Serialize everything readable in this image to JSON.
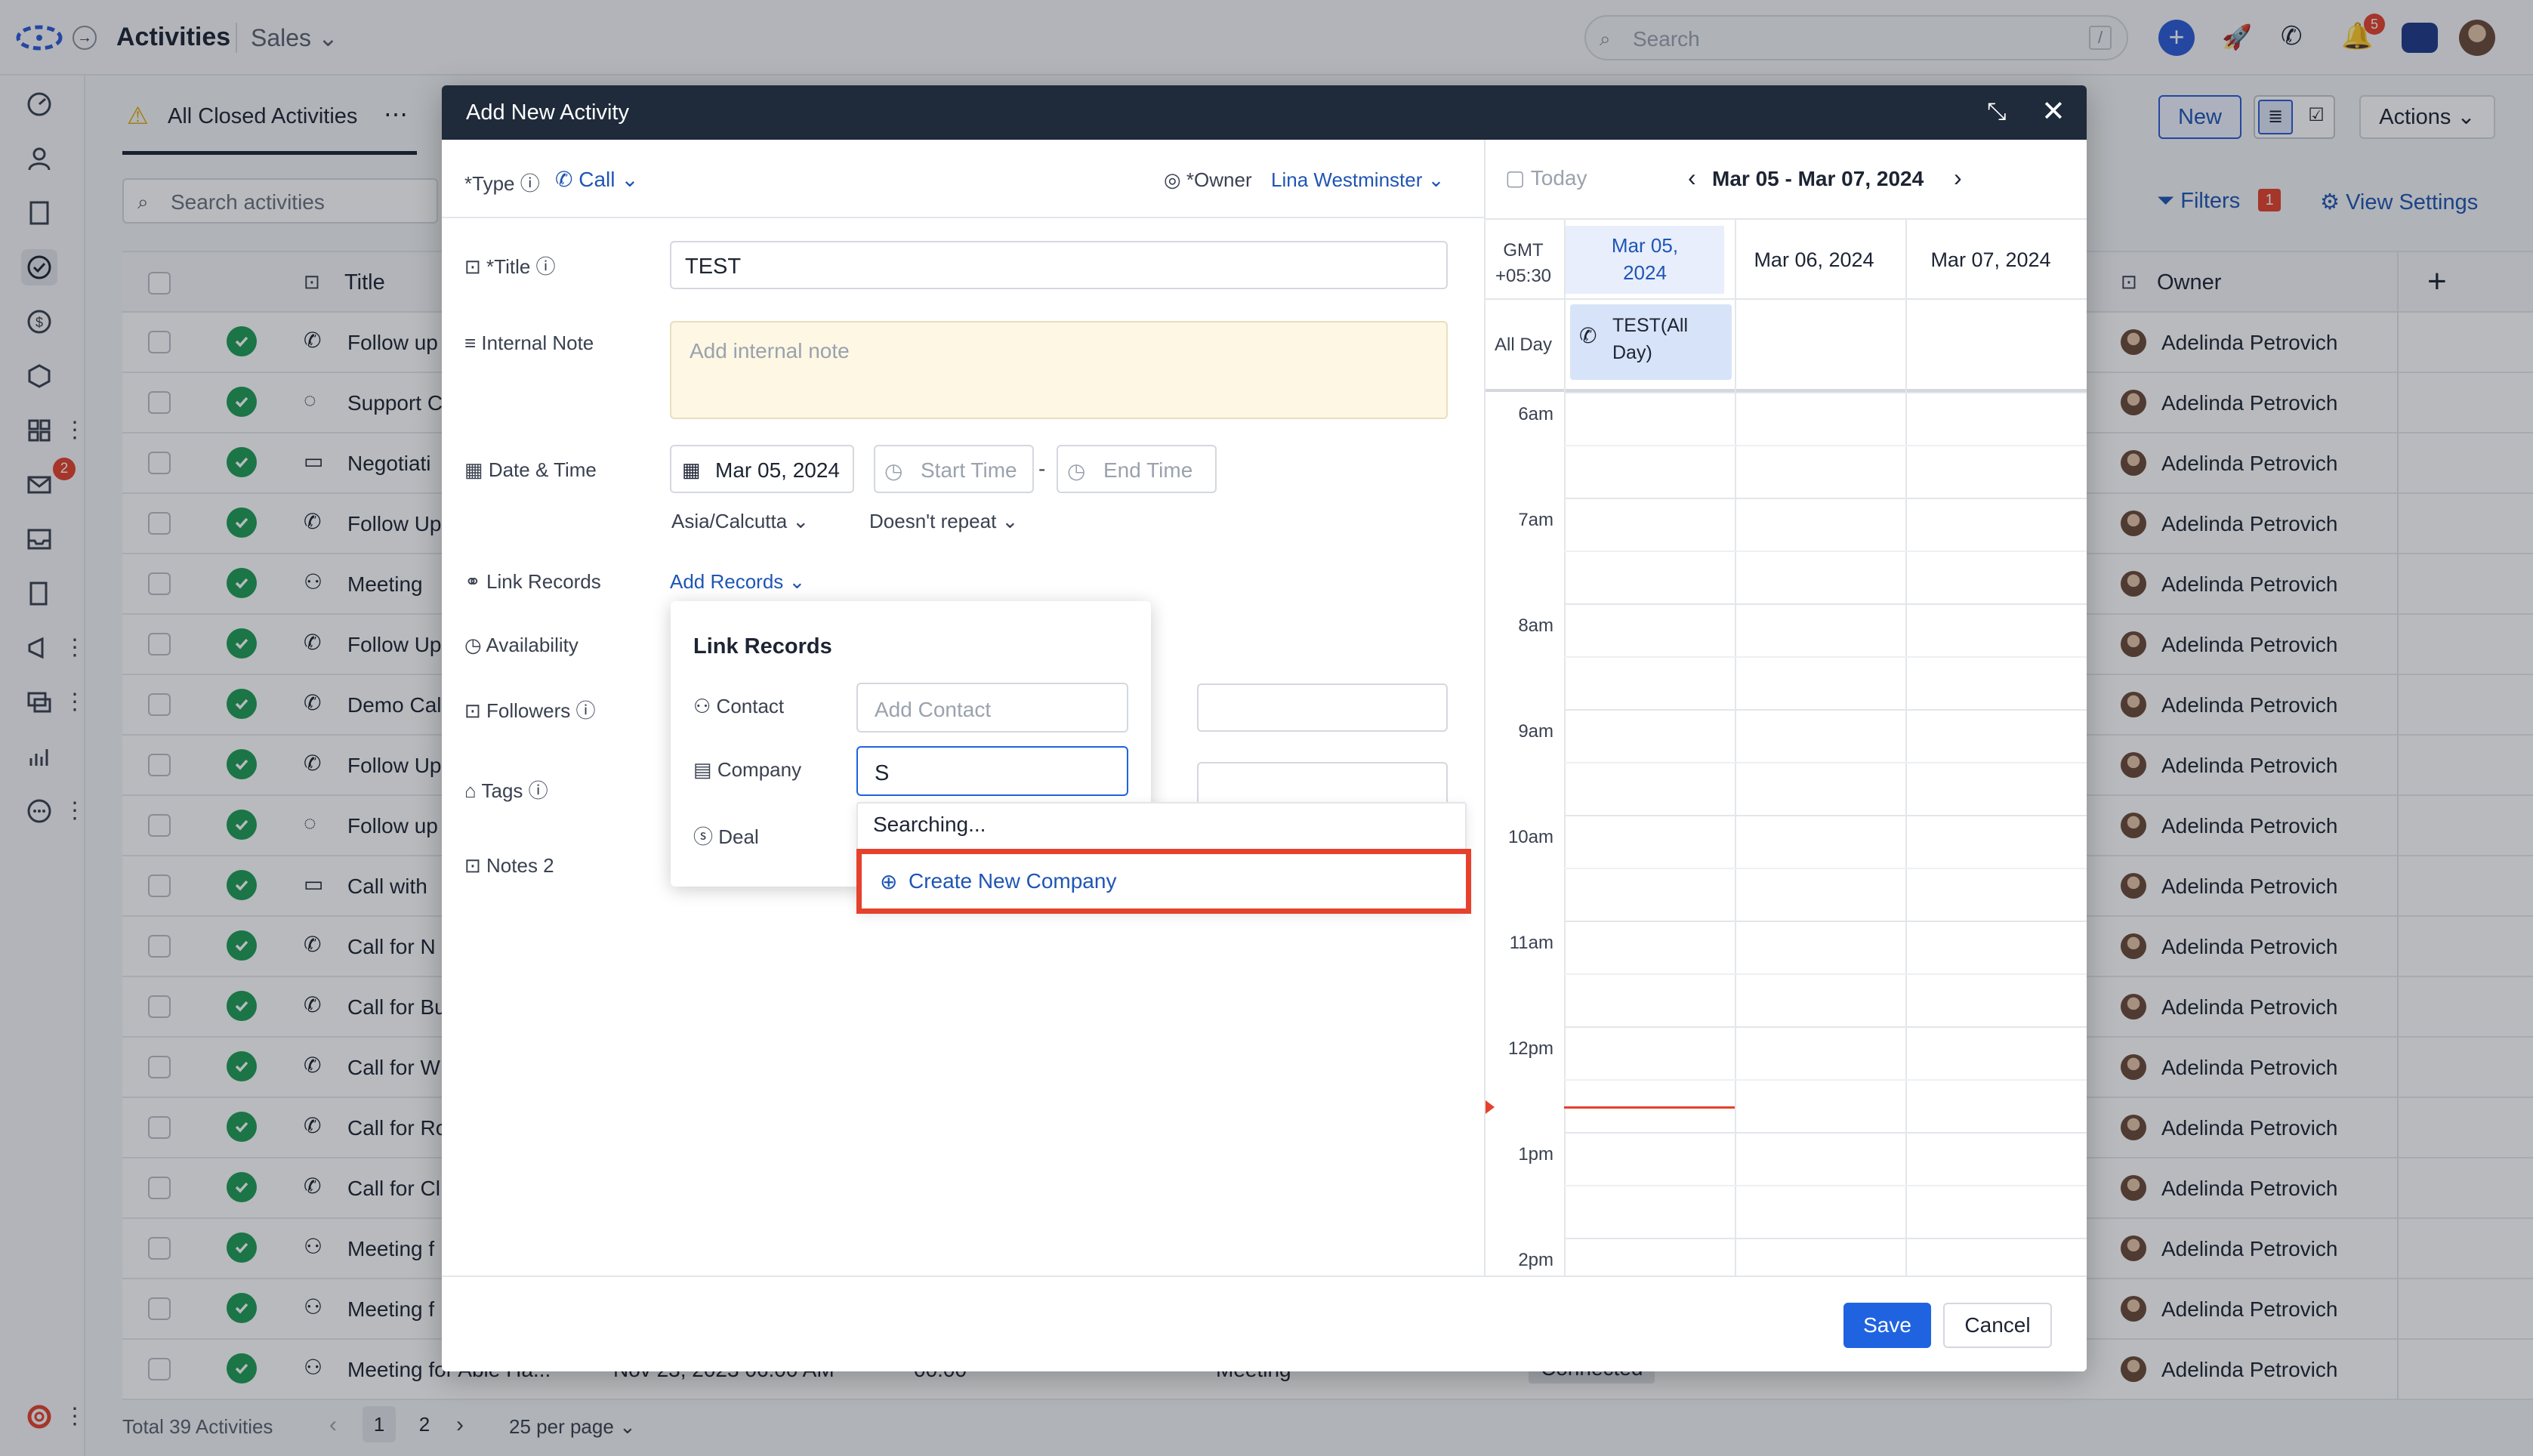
{
  "app": {
    "title": "Activities",
    "module": "Sales",
    "search_placeholder": "Search",
    "search_shortcut": "/",
    "notif_count": "5"
  },
  "sidebar": {
    "mail_badge": "2"
  },
  "list": {
    "view_name": "All Closed Activities",
    "search_placeholder": "Search activities",
    "new_label": "New",
    "actions_label": "Actions",
    "filters_label": "Filters",
    "filters_count": "1",
    "view_settings_label": "View Settings",
    "col_title": "Title",
    "col_owner": "Owner",
    "rows": [
      {
        "title": "Follow up",
        "icon": "phone-icon",
        "owner": "Adelinda Petrovich"
      },
      {
        "title": "Support C",
        "icon": "bulb-icon",
        "owner": "Adelinda Petrovich"
      },
      {
        "title": "Negotiati",
        "icon": "chat-icon",
        "owner": "Adelinda Petrovich"
      },
      {
        "title": "Follow Up",
        "icon": "phone-icon",
        "owner": "Adelinda Petrovich"
      },
      {
        "title": "Meeting",
        "icon": "people-icon",
        "owner": "Adelinda Petrovich"
      },
      {
        "title": "Follow Up",
        "icon": "phone-icon",
        "owner": "Adelinda Petrovich"
      },
      {
        "title": "Demo Cal",
        "icon": "phone-icon",
        "owner": "Adelinda Petrovich"
      },
      {
        "title": "Follow Up",
        "icon": "phone-icon",
        "owner": "Adelinda Petrovich"
      },
      {
        "title": "Follow up",
        "icon": "bulb-icon",
        "owner": "Adelinda Petrovich"
      },
      {
        "title": "Call with",
        "icon": "chat-icon",
        "owner": "Adelinda Petrovich"
      },
      {
        "title": "Call for N",
        "icon": "phone-icon",
        "owner": "Adelinda Petrovich"
      },
      {
        "title": "Call for Bu",
        "icon": "phone-icon",
        "owner": "Adelinda Petrovich"
      },
      {
        "title": "Call for W",
        "icon": "phone-icon",
        "owner": "Adelinda Petrovich"
      },
      {
        "title": "Call for Ro",
        "icon": "phone-icon",
        "owner": "Adelinda Petrovich"
      },
      {
        "title": "Call for Cl",
        "icon": "phone-icon",
        "owner": "Adelinda Petrovich"
      },
      {
        "title": "Meeting f",
        "icon": "people-icon",
        "owner": "Adelinda Petrovich"
      },
      {
        "title": "Meeting f",
        "icon": "people-icon",
        "owner": "Adelinda Petrovich"
      },
      {
        "title": "Meeting for Able Ha...",
        "icon": "people-icon",
        "owner": "Adelinda Petrovich",
        "date": "Nov 23, 2023 06:00 AM",
        "duration": "00:00",
        "type": "Meeting",
        "outcome": "Connected"
      }
    ],
    "total_label": "Total 39 Activities",
    "pages": [
      "1",
      "2"
    ],
    "per_page": "25 per page"
  },
  "modal": {
    "title": "Add New Activity",
    "type_label": "*Type",
    "type_value": "Call",
    "owner_label": "*Owner",
    "owner_value": "Lina Westminster",
    "title_label": "*Title",
    "title_value": "TEST",
    "note_label": "Internal Note",
    "note_placeholder": "Add internal note",
    "datetime_label": "Date & Time",
    "date_value": "Mar 05, 2024",
    "start_placeholder": "Start Time",
    "dash": "-",
    "end_placeholder": "End Time",
    "timezone": "Asia/Calcutta",
    "repeat": "Doesn't repeat",
    "link_label": "Link Records",
    "add_records": "Add Records",
    "availability_label": "Availability",
    "followers_label": "Followers",
    "tags_label": "Tags",
    "notes_label": "Notes 2",
    "save_label": "Save",
    "cancel_label": "Cancel"
  },
  "popover": {
    "title": "Link Records",
    "contact_label": "Contact",
    "contact_placeholder": "Add Contact",
    "company_label": "Company",
    "company_value": "S",
    "deal_label": "Deal",
    "searching": "Searching...",
    "create_new": "Create New Company",
    "highlight_color": "#e5412d"
  },
  "calendar": {
    "today_label": "Today",
    "range": "Mar 05 - Mar 07, 2024",
    "tz_line1": "GMT",
    "tz_line2": "+05:30",
    "day1_line1": "Mar 05,",
    "day1_line2": "2024",
    "day2": "Mar 06, 2024",
    "day3": "Mar 07, 2024",
    "all_day_label": "All Day",
    "event_line1": "TEST(All",
    "event_line2": "Day)",
    "hours": [
      "6am",
      "7am",
      "8am",
      "9am",
      "10am",
      "11am",
      "12pm",
      "1pm",
      "2pm"
    ],
    "accent": "#1f55b5"
  }
}
